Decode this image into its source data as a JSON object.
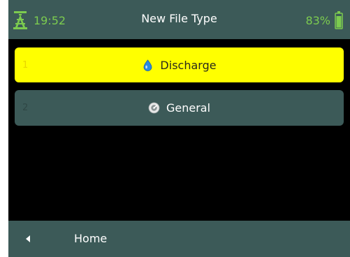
{
  "header": {
    "time": "19:52",
    "title": "New File Type",
    "battery": "83%",
    "signal_icon": "tower-icon",
    "battery_icon": "battery-icon"
  },
  "menu": {
    "items": [
      {
        "number": "1",
        "label": "Discharge",
        "icon": "water-drop-icon",
        "selected": true
      },
      {
        "number": "2",
        "label": "General",
        "icon": "general-icon",
        "selected": false
      }
    ]
  },
  "footer": {
    "back_label": "Home",
    "back_icon": "back-arrow-icon"
  },
  "colors": {
    "bar_background": "#3c5a58",
    "selected_background": "#ffff00",
    "status_text": "#7ccb4f",
    "screen_background": "#000000"
  }
}
